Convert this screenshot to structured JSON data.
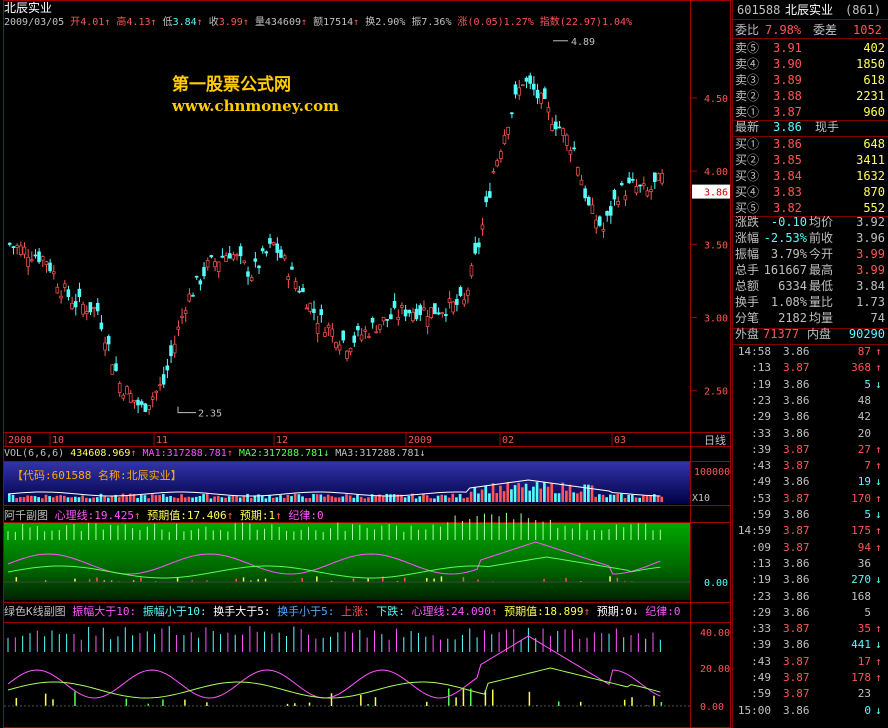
{
  "header": {
    "name": "北辰实业",
    "date": "2009/03/05",
    "open_label": "开",
    "open": "4.01",
    "high_label": "高",
    "high": "4.13",
    "low_label": "低",
    "low": "3.84",
    "close_label": "收",
    "close": "3.99",
    "vol_label": "量",
    "vol": "434609",
    "amt_label": "额",
    "amt": "17514",
    "turn_label": "换",
    "turn": "2.90%",
    "amp_label": "振",
    "amp": "7.36%",
    "chg_label": "涨",
    "chg": "(0.05)",
    "chg_pct": "1.27%",
    "idx_label": "指数",
    "idx": "(22.97)",
    "idx_pct": "1.04%"
  },
  "watermark": {
    "line1": "第一股票公式网",
    "line2": "www.chnmoney.com"
  },
  "price_axis": {
    "ticks": [
      "4.50",
      "4.00",
      "3.50",
      "3.00",
      "2.50"
    ],
    "current": "3.86",
    "max_label": "4.89",
    "min_label": "2.35",
    "period": "日线"
  },
  "date_axis": [
    "2008",
    "10",
    "11",
    "12",
    "2009",
    "02",
    "03"
  ],
  "vol_panel": {
    "title": "VOL(6,6,6)",
    "value": "434608.969",
    "ma1": "MA1:317288.781",
    "ma2": "MA2:317288.781",
    "ma3": "MA3:317288.781",
    "tick": "100000",
    "mult": "X10",
    "code_box": "【代码:601588 名称:北辰实业】"
  },
  "panel1": {
    "title": "阿千副图",
    "l1": "心理线:19.425",
    "l2": "预期值:17.406",
    "l3": "预期:1",
    "l4": "纪律:0",
    "tick": "0.00"
  },
  "panel2": {
    "title": "绿色K线副图",
    "l1": "振幅大于10:",
    "l2": "振幅小于10:",
    "l3": "换手大于5:",
    "l4": "换手小于5:",
    "l5": "上涨:",
    "l6": "下跌:",
    "l7": "心理线:24.090",
    "l8": "预期值:18.899",
    "l9": "预期:0",
    "l10": "纪律:0",
    "ticks": [
      "40.00",
      "20.00",
      "0.00"
    ]
  },
  "quote": {
    "code": "601588",
    "name": "北辰实业",
    "seq": "(861)",
    "weibi_label": "委比",
    "weibi": "7.98%",
    "weicha_label": "委差",
    "weicha": "1052",
    "sells": [
      {
        "l": "卖⑤",
        "p": "3.91",
        "v": "402"
      },
      {
        "l": "卖④",
        "p": "3.90",
        "v": "1850"
      },
      {
        "l": "卖③",
        "p": "3.89",
        "v": "618"
      },
      {
        "l": "卖②",
        "p": "3.88",
        "v": "2231"
      },
      {
        "l": "卖①",
        "p": "3.87",
        "v": "960"
      }
    ],
    "last_label": "最新",
    "last": "3.86",
    "xianshou": "现手",
    "buys": [
      {
        "l": "买①",
        "p": "3.86",
        "v": "648"
      },
      {
        "l": "买②",
        "p": "3.85",
        "v": "3411"
      },
      {
        "l": "买③",
        "p": "3.84",
        "v": "1632"
      },
      {
        "l": "买④",
        "p": "3.83",
        "v": "870"
      },
      {
        "l": "买⑤",
        "p": "3.82",
        "v": "552"
      }
    ],
    "stats": [
      {
        "a": "涨跌",
        "av": "-0.10",
        "b": "均价",
        "bv": "3.92"
      },
      {
        "a": "涨幅",
        "av": "-2.53%",
        "b": "前收",
        "bv": "3.96"
      },
      {
        "a": "振幅",
        "av": "3.79%",
        "b": "今开",
        "bv": "3.99"
      },
      {
        "a": "总手",
        "av": "161667",
        "b": "最高",
        "bv": "3.99"
      },
      {
        "a": "总额",
        "av": "6334",
        "b": "最低",
        "bv": "3.84"
      },
      {
        "a": "换手",
        "av": "1.08%",
        "b": "量比",
        "bv": "1.73"
      },
      {
        "a": "分笔",
        "av": "2182",
        "b": "均量",
        "bv": "74"
      }
    ],
    "waipan_label": "外盘",
    "waipan": "71377",
    "neipan_label": "内盘",
    "neipan": "90290"
  },
  "ticks": [
    {
      "t": "14:58",
      "p": "3.86",
      "v": "87",
      "d": "up"
    },
    {
      "t": ":13",
      "p": "3.87",
      "v": "368",
      "d": "up"
    },
    {
      "t": ":19",
      "p": "3.86",
      "v": "5",
      "d": "down"
    },
    {
      "t": ":23",
      "p": "3.86",
      "v": "48",
      "d": ""
    },
    {
      "t": ":29",
      "p": "3.86",
      "v": "42",
      "d": ""
    },
    {
      "t": ":33",
      "p": "3.86",
      "v": "20",
      "d": ""
    },
    {
      "t": ":39",
      "p": "3.87",
      "v": "27",
      "d": "up"
    },
    {
      "t": ":43",
      "p": "3.87",
      "v": "7",
      "d": "up"
    },
    {
      "t": ":49",
      "p": "3.86",
      "v": "19",
      "d": "down"
    },
    {
      "t": ":53",
      "p": "3.87",
      "v": "170",
      "d": "up"
    },
    {
      "t": ":59",
      "p": "3.86",
      "v": "5",
      "d": "down"
    },
    {
      "t": "14:59",
      "p": "3.87",
      "v": "175",
      "d": "up"
    },
    {
      "t": ":09",
      "p": "3.87",
      "v": "94",
      "d": "up"
    },
    {
      "t": ":13",
      "p": "3.86",
      "v": "36",
      "d": ""
    },
    {
      "t": ":19",
      "p": "3.86",
      "v": "270",
      "d": "down"
    },
    {
      "t": ":23",
      "p": "3.86",
      "v": "168",
      "d": ""
    },
    {
      "t": ":29",
      "p": "3.86",
      "v": "5",
      "d": ""
    },
    {
      "t": ":33",
      "p": "3.87",
      "v": "35",
      "d": "up"
    },
    {
      "t": ":39",
      "p": "3.86",
      "v": "441",
      "d": "down"
    },
    {
      "t": ":43",
      "p": "3.87",
      "v": "17",
      "d": "up"
    },
    {
      "t": ":49",
      "p": "3.87",
      "v": "178",
      "d": "up"
    },
    {
      "t": ":59",
      "p": "3.87",
      "v": "23",
      "d": ""
    },
    {
      "t": "15:00",
      "p": "3.86",
      "v": "0",
      "d": "down"
    }
  ],
  "chart_data": {
    "type": "candlestick",
    "title": "北辰实业",
    "ylim": [
      2.3,
      4.95
    ],
    "max": 4.89,
    "min": 2.35,
    "last": 3.86,
    "period": "日线"
  }
}
